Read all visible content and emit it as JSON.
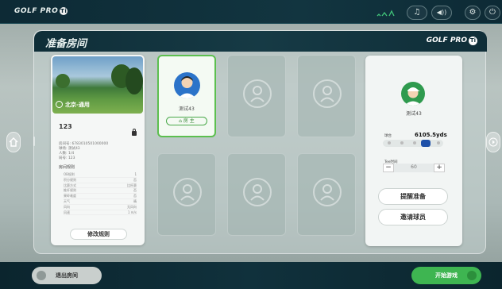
{
  "topbar": {
    "logo": "GOLF PRO",
    "logo_ball": "Ti",
    "music_icon": "♫",
    "sound_icon": "◀))",
    "settings_icon": "⚙",
    "power_icon": "⏻"
  },
  "panel": {
    "title": "准备房间",
    "logo": "GOLF PRO",
    "logo_ball": "Ti"
  },
  "course": {
    "location": "北京-通用",
    "room_no": "123",
    "info": [
      "房间号: 6783010501000000",
      "球场: 测试43",
      "人数: 1/4",
      "局号: 123"
    ],
    "rules_title": "房间规则",
    "rules": [
      {
        "k": "OB规则",
        "v": "1"
      },
      {
        "k": "积分规则",
        "v": "否"
      },
      {
        "k": "比赛方式",
        "v": "比杆赛"
      },
      {
        "k": "推杆规则",
        "v": "否"
      },
      {
        "k": "果岭难度",
        "v": "否"
      },
      {
        "k": "天气",
        "v": "晴"
      },
      {
        "k": "风向",
        "v": "无风向"
      },
      {
        "k": "风速",
        "v": "1 m/s"
      }
    ],
    "edit_button": "修改规则"
  },
  "slots": {
    "owner_name": "测试43",
    "owner_badge": "房 主"
  },
  "player": {
    "name": "测试43",
    "tee_label": "球台",
    "tee_value": "6105.5yds",
    "time_label": "Tee时间",
    "time_value": "60",
    "minus": "−",
    "plus": "+",
    "remind_button": "提醒准备",
    "invite_button": "邀请球员"
  },
  "bottom": {
    "exit_button": "退出房间",
    "start_button": "开始游戏"
  },
  "colors": {
    "accent_green": "#3eb551",
    "header_dark": "#0f2e38",
    "tee_active": "#1e50a8"
  }
}
